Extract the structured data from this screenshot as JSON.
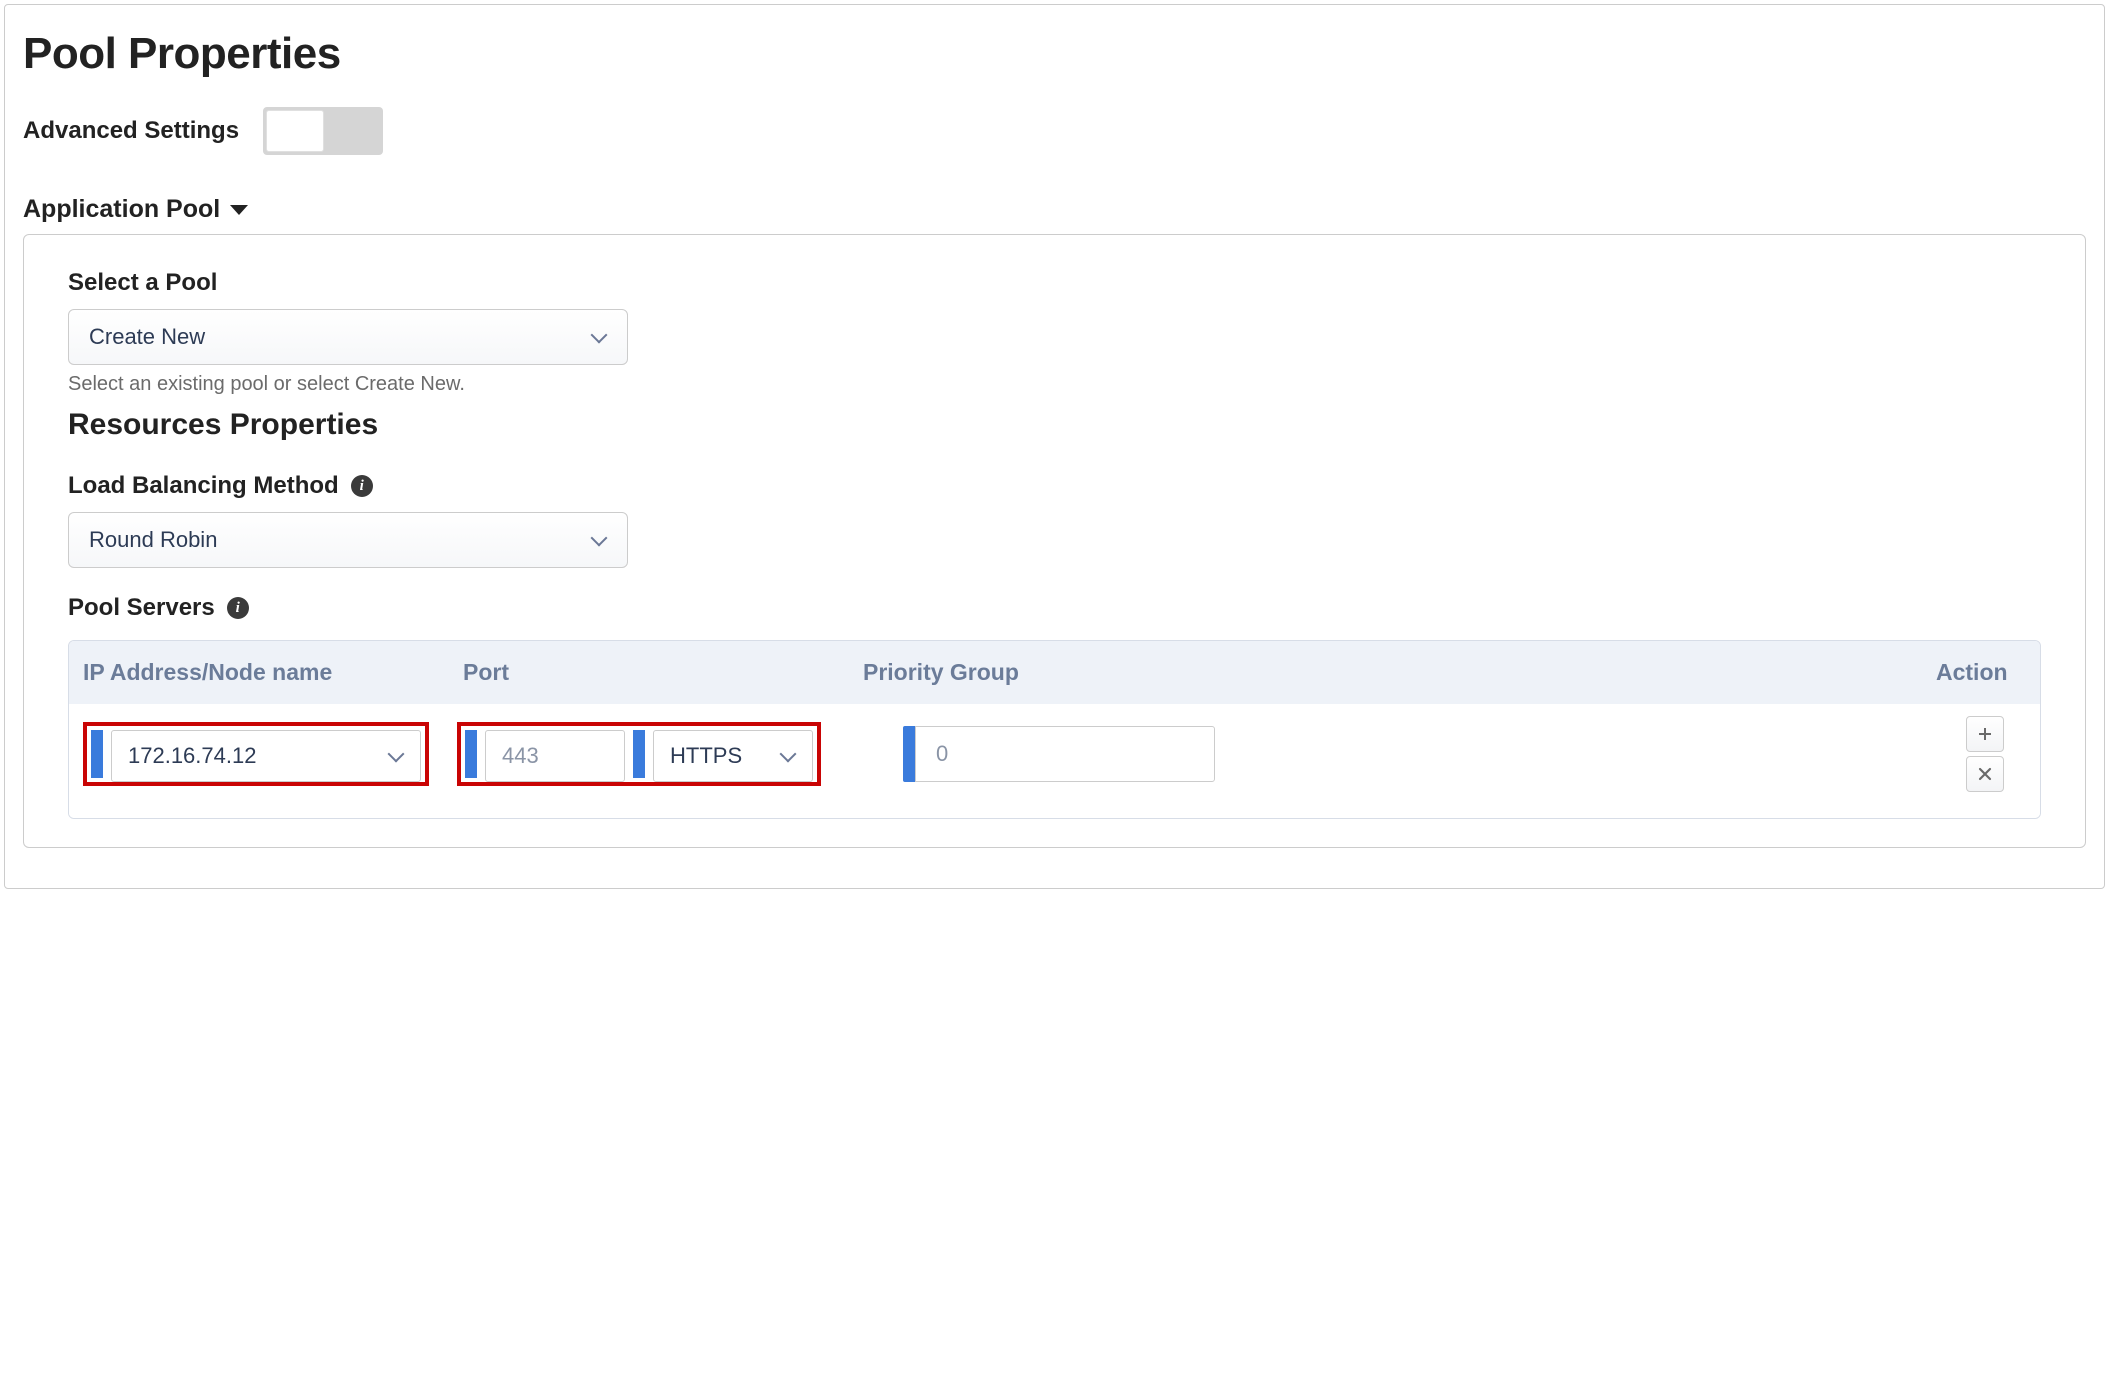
{
  "page": {
    "title": "Pool Properties",
    "advanced_label": "Advanced Settings"
  },
  "section": {
    "header": "Application Pool"
  },
  "select_pool": {
    "label": "Select a Pool",
    "value": "Create New",
    "help": "Select an existing pool or select Create New."
  },
  "resources": {
    "title": "Resources Properties",
    "lb_label": "Load Balancing Method",
    "lb_value": "Round Robin",
    "servers_label": "Pool Servers"
  },
  "servers": {
    "columns": {
      "ip": "IP Address/Node name",
      "port": "Port",
      "priority": "Priority Group",
      "action": "Action"
    },
    "rows": [
      {
        "ip": "172.16.74.12",
        "port": "443",
        "protocol": "HTTPS",
        "priority": "0"
      }
    ]
  }
}
